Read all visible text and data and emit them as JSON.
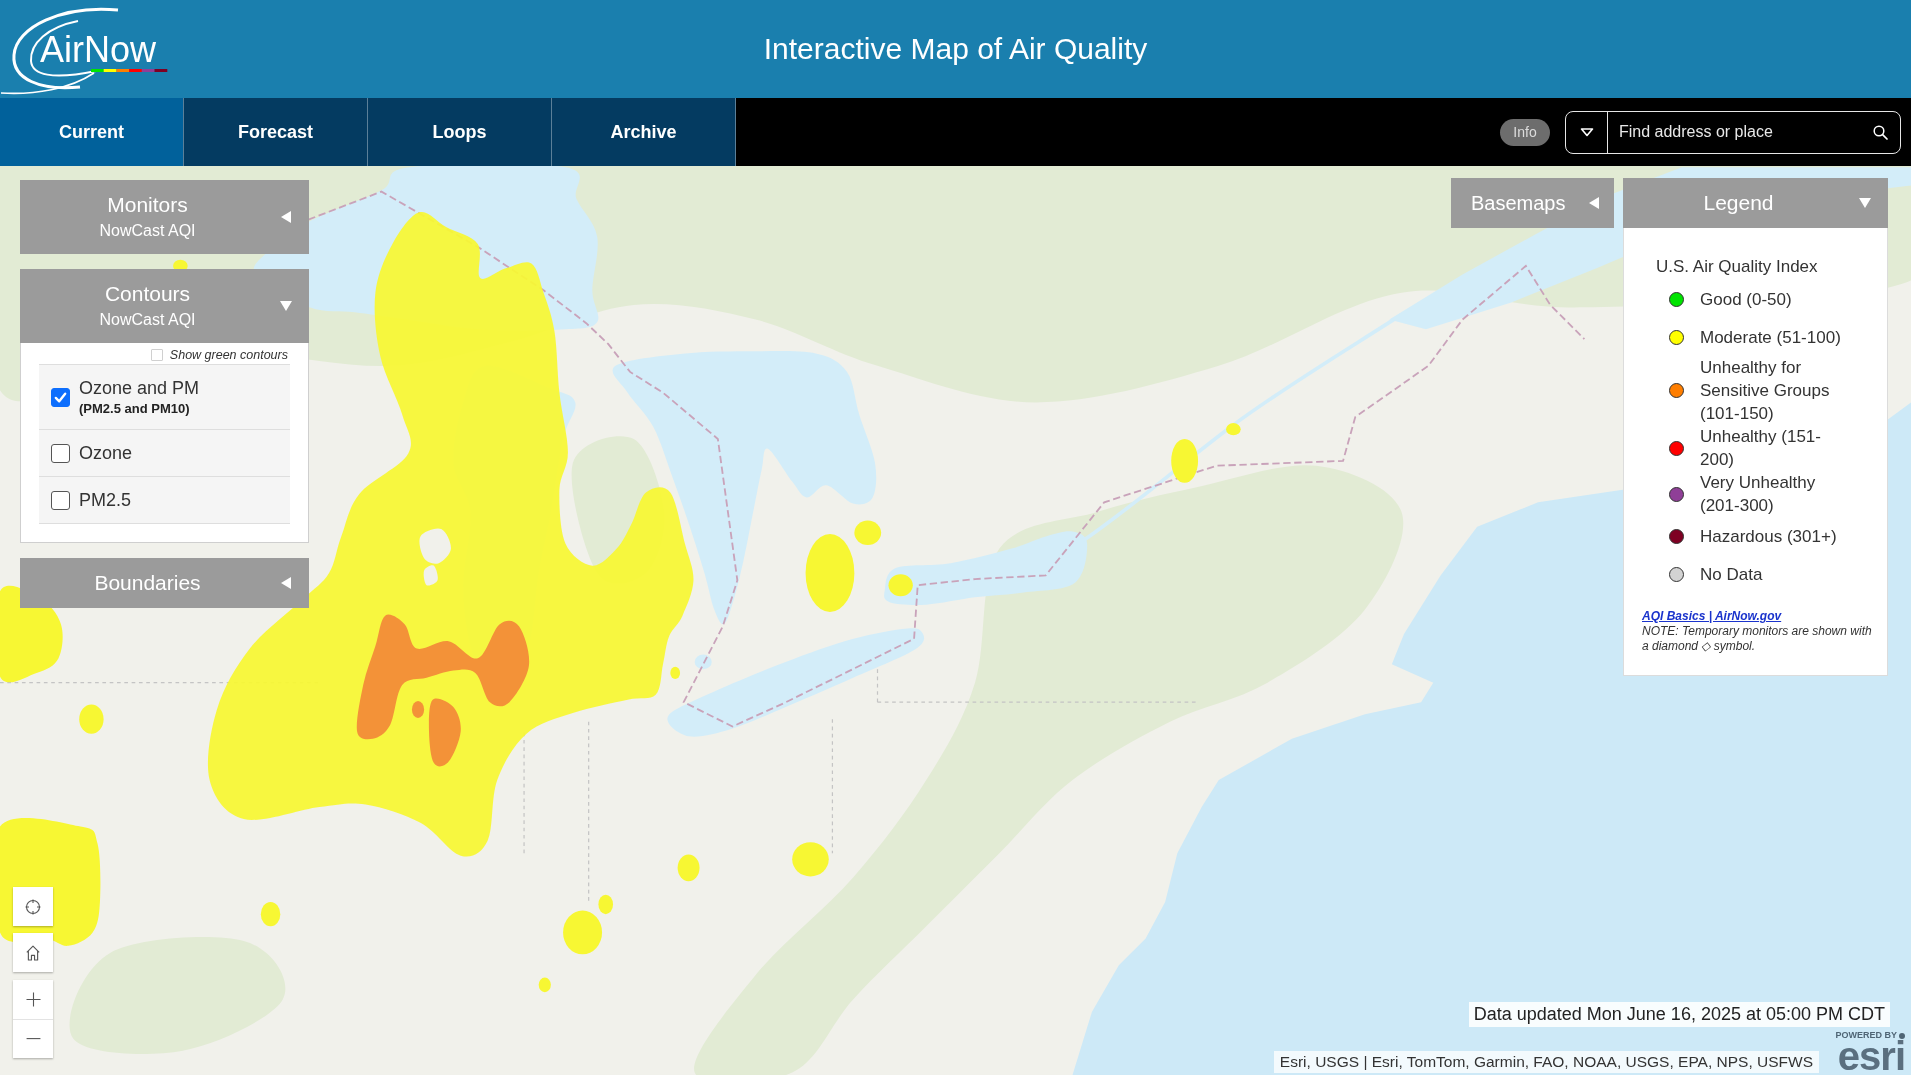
{
  "header": {
    "logo": "AirNow",
    "title": "Interactive Map of Air Quality"
  },
  "nav": {
    "tabs": [
      {
        "label": "Current",
        "selected": true
      },
      {
        "label": "Forecast",
        "selected": false
      },
      {
        "label": "Loops",
        "selected": false
      },
      {
        "label": "Archive",
        "selected": false
      }
    ],
    "info_button": "Info",
    "search": {
      "placeholder": "Find address or place"
    }
  },
  "layer_panels": [
    {
      "title": "Monitors",
      "subtitle": "NowCast AQI",
      "expanded": false
    },
    {
      "title": "Contours",
      "subtitle": "NowCast AQI",
      "expanded": true,
      "green_toggle": {
        "label": "Show green contours",
        "checked": false
      },
      "options": [
        {
          "label": "Ozone and PM",
          "sublabel": "(PM2.5 and PM10)",
          "checked": true
        },
        {
          "label": "Ozone",
          "checked": false
        },
        {
          "label": "PM2.5",
          "checked": false
        }
      ]
    },
    {
      "title": "Boundaries",
      "expanded": false
    }
  ],
  "basemaps_button": {
    "label": "Basemaps",
    "expanded": false
  },
  "legend": {
    "title": "Legend",
    "expanded": true,
    "heading": "U.S. Air Quality Index",
    "items": [
      {
        "label": "Good (0-50)",
        "color": "#00e400"
      },
      {
        "label": "Moderate (51-100)",
        "color": "#ffff00"
      },
      {
        "label": "Unhealthy for Sensitive Groups (101-150)",
        "color": "#ff7e00"
      },
      {
        "label": "Unhealthy (151-200)",
        "color": "#ff0000"
      },
      {
        "label": "Very Unhealthy (201-300)",
        "color": "#8f3f97"
      },
      {
        "label": "Hazardous (301+)",
        "color": "#7e0023"
      },
      {
        "label": "No Data",
        "color": "#d3d3d3"
      }
    ],
    "link": "AQI Basics | AirNow.gov",
    "note": "NOTE: Temporary monitors are shown with a diamond ◇ symbol."
  },
  "map": {
    "data_updated": "Data updated Mon June 16, 2025 at 05:00 PM CDT",
    "attribution": "Esri, USGS | Esri, TomTom, Garmin, FAO, NOAA, USGS, EPA, NPS, USFWS",
    "esri_logo": {
      "caption": "POWERED BY",
      "wordmark": "esri"
    }
  }
}
